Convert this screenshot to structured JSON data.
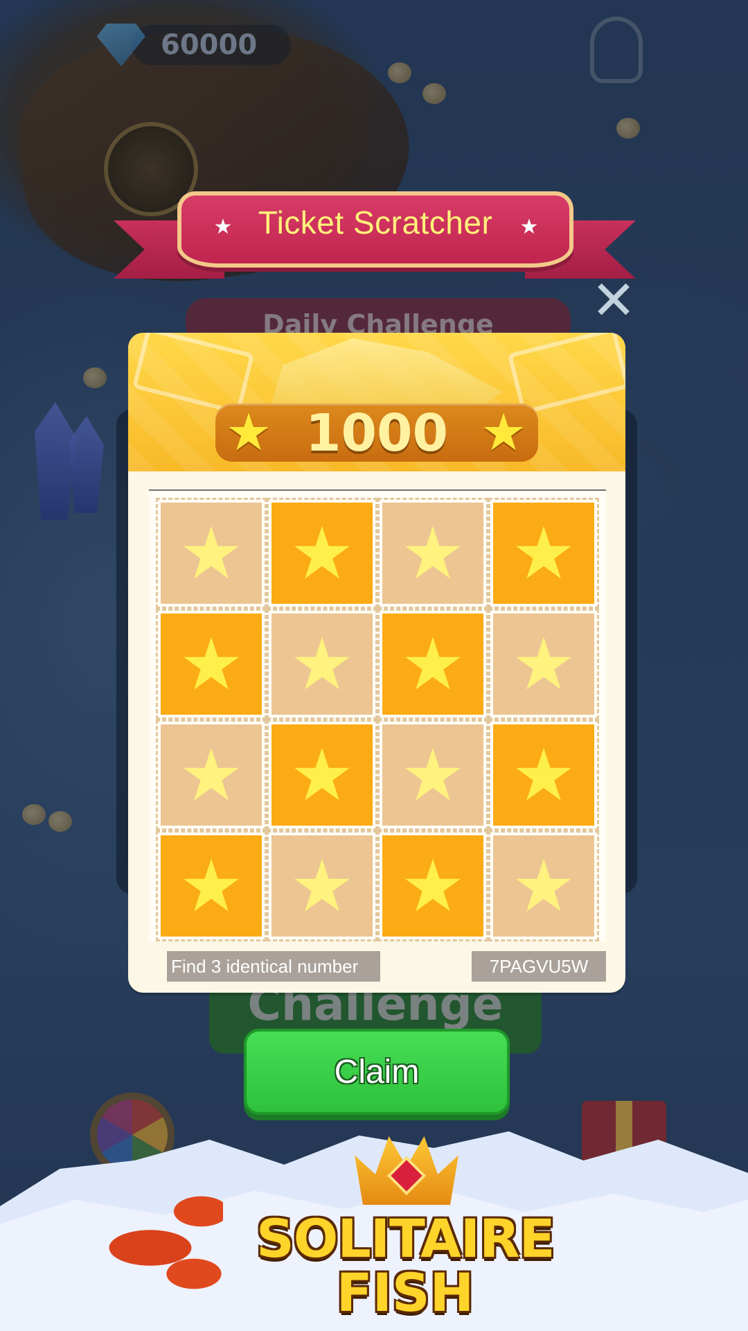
{
  "hud": {
    "gems": "60000",
    "gems_icon": "diamond-icon",
    "hint_icon": "lightbulb-icon"
  },
  "background": {
    "daily_challenge": "Daily Challenge",
    "challenge_button": "Challenge"
  },
  "modal": {
    "title": "Ticket Scratcher",
    "close_icon": "close-icon",
    "reward_amount": "1000",
    "hint": "Find 3 identical number",
    "ticket_code": "7PAGVU5W",
    "claim_label": "Claim",
    "grid": [
      [
        "tan",
        "orange",
        "tan",
        "orange"
      ],
      [
        "orange",
        "tan",
        "orange",
        "tan"
      ],
      [
        "tan",
        "orange",
        "tan",
        "orange"
      ],
      [
        "orange",
        "tan",
        "orange",
        "tan"
      ]
    ]
  },
  "ad_banner": {
    "logo_line1": "SOLITAIRE",
    "logo_line2": "FISH"
  },
  "colors": {
    "orange_cell": "#fbab14",
    "tan_cell": "#ecc592",
    "claim_green": "#3ad048",
    "ribbon_pink": "#c9305a",
    "title_yellow": "#fff27a"
  }
}
